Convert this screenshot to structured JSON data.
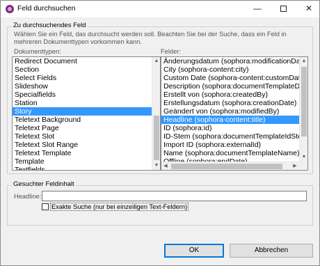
{
  "window": {
    "title": "Feld durchsuchen",
    "minimize_glyph": "—",
    "close_glyph": "✕"
  },
  "search_group": {
    "title": "Zu durchsuchendes Feld",
    "description": "Wählen Sie ein Feld, das durchsucht werden soll. Beachten Sie bei der Suche, dass ein Feld in mehreren Dokumenttypen vorkommen kann.",
    "doctypes_label": "Dokumenttypen:",
    "fields_label": "Felder:",
    "doctypes": [
      "Redirect Document",
      "Section",
      "Select Fields",
      "Slideshow",
      "Specialfields",
      "Station",
      "Story",
      "Teletext Background",
      "Teletext Page",
      "Teletext Slot",
      "Teletext Slot Range",
      "Teletext Template",
      "Template",
      "Textfields"
    ],
    "doctypes_selected": "Story",
    "fields": [
      "Änderungsdatum (sophora:modificationDate)",
      "City (sophora-content:city)",
      "Custom Date (sophora-content:customDate)",
      "Description (sophora:documentTemplateDesc",
      "Erstellt von (sophora:createdBy)",
      "Erstellungsdatum (sophora:creationDate)",
      "Geändert von (sophora:modifiedBy)",
      "Headline (sophora-content:title)",
      "ID (sophora:id)",
      "ID-Stem (sophora:documentTemplateIdStem)",
      "Import ID (sophora:externalId)",
      "Name (sophora:documentTemplateName)",
      "Offline (sophora:endDate)"
    ],
    "fields_selected": "Headline (sophora-content:title)",
    "scroll_up_glyph": "▲",
    "scroll_down_glyph": "▼",
    "scroll_left_glyph": "◀",
    "scroll_right_glyph": "▶"
  },
  "content_group": {
    "title": "Gesuchter Feldinhalt",
    "headline_label": "Headline:",
    "headline_value": "",
    "exact_search_label": "Exakte Suche (nur bei einzeiligen Text-Feldern)",
    "exact_search_checked": false
  },
  "buttons": {
    "ok": "OK",
    "cancel": "Abbrechen"
  }
}
